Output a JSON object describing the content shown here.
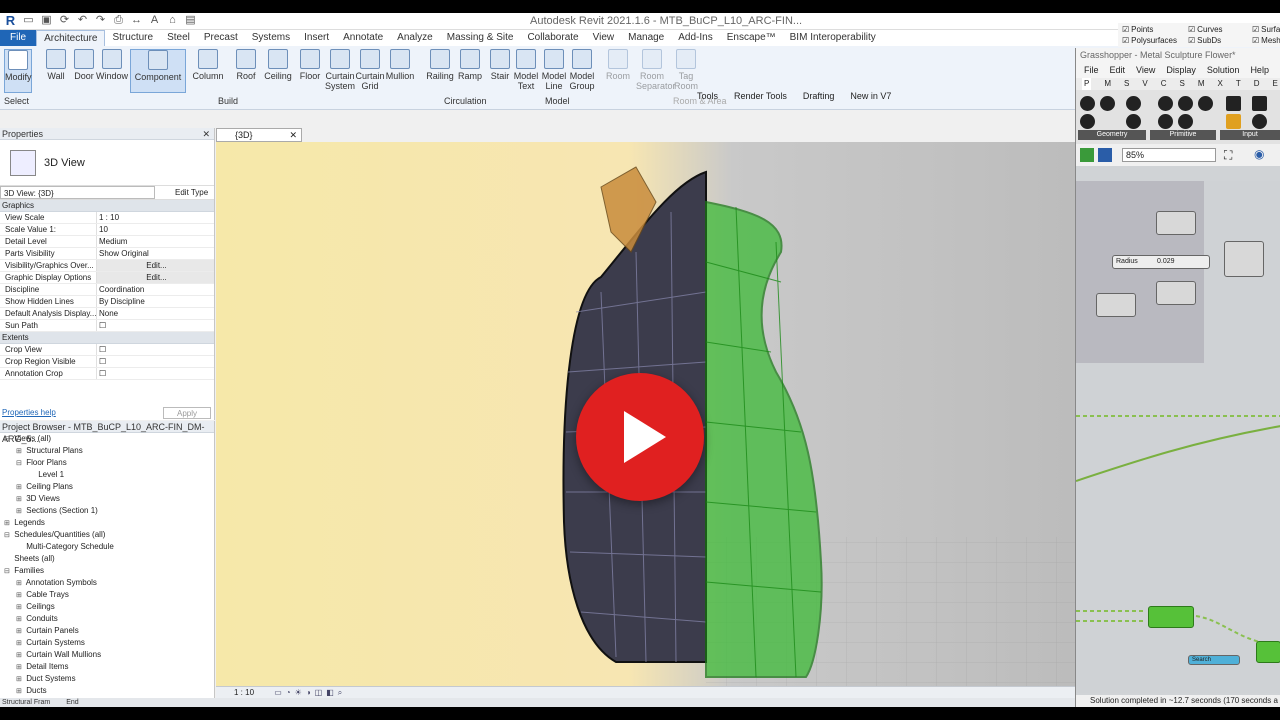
{
  "window": {
    "app_title": "Autodesk Revit 2021.1.6 - MTB_BuCP_L10_ARC-FIN..."
  },
  "ribbon_tabs": [
    "File",
    "Architecture",
    "Structure",
    "Steel",
    "Precast",
    "Systems",
    "Insert",
    "Annotate",
    "Analyze",
    "Massing & Site",
    "Collaborate",
    "View",
    "Manage",
    "Add-Ins",
    "Enscape™",
    "BIM Interoperability"
  ],
  "ribbon": {
    "modify": "Modify",
    "select": "Select",
    "build_buttons": [
      "Wall",
      "Door",
      "Window",
      "Component",
      "Column",
      "Roof",
      "Ceiling",
      "Floor",
      "Curtain System",
      "Curtain Grid",
      "Mullion"
    ],
    "circulation_buttons": [
      "Railing",
      "Ramp",
      "Stair"
    ],
    "model_buttons": [
      "Model Text",
      "Model Line",
      "Model Group"
    ],
    "room_buttons": [
      "Room",
      "Room Separator",
      "Tag Room"
    ],
    "panels": {
      "build": "Build",
      "circulation": "Circulation",
      "model": "Model",
      "room": "Room & Area"
    },
    "extra_tabs": [
      "Tools",
      "Render Tools",
      "Drafting",
      "New in V7"
    ]
  },
  "properties": {
    "title": "Properties",
    "type_name": "3D View",
    "selector": "3D View: {3D}",
    "edit_type": "Edit Type",
    "group_graphics": "Graphics",
    "rows": [
      {
        "k": "View Scale",
        "v": "1 : 10"
      },
      {
        "k": "Scale Value    1:",
        "v": "10"
      },
      {
        "k": "Detail Level",
        "v": "Medium"
      },
      {
        "k": "Parts Visibility",
        "v": "Show Original"
      },
      {
        "k": "Visibility/Graphics Over...",
        "v": "Edit..."
      },
      {
        "k": "Graphic Display Options",
        "v": "Edit..."
      },
      {
        "k": "Discipline",
        "v": "Coordination"
      },
      {
        "k": "Show Hidden Lines",
        "v": "By Discipline"
      },
      {
        "k": "Default Analysis Display...",
        "v": "None"
      },
      {
        "k": "Sun Path",
        "v": ""
      }
    ],
    "group_extents": "Extents",
    "extents_rows": [
      "Crop View",
      "Crop Region Visible",
      "Annotation Crop"
    ],
    "help": "Properties help",
    "apply": "Apply"
  },
  "browser": {
    "title": "Project Browser - MTB_BuCP_L10_ARC-FIN_DM-ARG_5...",
    "items": [
      {
        "indent": 0,
        "exp": "⊟",
        "label": "Views (all)"
      },
      {
        "indent": 1,
        "exp": "⊞",
        "label": "Structural Plans"
      },
      {
        "indent": 1,
        "exp": "⊟",
        "label": "Floor Plans"
      },
      {
        "indent": 2,
        "exp": "",
        "label": "Level 1"
      },
      {
        "indent": 1,
        "exp": "⊞",
        "label": "Ceiling Plans"
      },
      {
        "indent": 1,
        "exp": "⊞",
        "label": "3D Views"
      },
      {
        "indent": 1,
        "exp": "⊞",
        "label": "Sections (Section 1)"
      },
      {
        "indent": 0,
        "exp": "⊞",
        "label": "Legends"
      },
      {
        "indent": 0,
        "exp": "⊟",
        "label": "Schedules/Quantities (all)"
      },
      {
        "indent": 1,
        "exp": "",
        "label": "Multi-Category Schedule"
      },
      {
        "indent": 0,
        "exp": "",
        "label": "Sheets (all)"
      },
      {
        "indent": 0,
        "exp": "⊟",
        "label": "Families"
      },
      {
        "indent": 1,
        "exp": "⊞",
        "label": "Annotation Symbols"
      },
      {
        "indent": 1,
        "exp": "⊞",
        "label": "Cable Trays"
      },
      {
        "indent": 1,
        "exp": "⊞",
        "label": "Ceilings"
      },
      {
        "indent": 1,
        "exp": "⊞",
        "label": "Conduits"
      },
      {
        "indent": 1,
        "exp": "⊞",
        "label": "Curtain Panels"
      },
      {
        "indent": 1,
        "exp": "⊞",
        "label": "Curtain Systems"
      },
      {
        "indent": 1,
        "exp": "⊞",
        "label": "Curtain Wall Mullions"
      },
      {
        "indent": 1,
        "exp": "⊞",
        "label": "Detail Items"
      },
      {
        "indent": 1,
        "exp": "⊞",
        "label": "Duct Systems"
      },
      {
        "indent": 1,
        "exp": "⊞",
        "label": "Ducts"
      }
    ]
  },
  "view": {
    "tab": "{3D}",
    "scale": "1 : 10"
  },
  "bottom": {
    "left": "Structural Fram",
    "end": "End"
  },
  "grasshopper": {
    "title": "Grasshopper - Metal Sculpture Flower*",
    "menu": [
      "File",
      "Edit",
      "View",
      "Display",
      "Solution",
      "Help"
    ],
    "tabs": [
      "P",
      "M",
      "S",
      "V",
      "C",
      "S",
      "M",
      "X",
      "T",
      "D",
      "E"
    ],
    "groups": [
      "Geometry",
      "Primitive",
      "Input"
    ],
    "zoom": "85%",
    "radius_label": "Radius",
    "radius_value": "0.029",
    "search_label": "Search",
    "status": "Solution completed in ~12.7 seconds (170 seconds a"
  },
  "rhino_checks": [
    "Points",
    "Curves",
    "Surfaces",
    "Polysurfaces",
    "SubDs",
    "Meshes"
  ]
}
